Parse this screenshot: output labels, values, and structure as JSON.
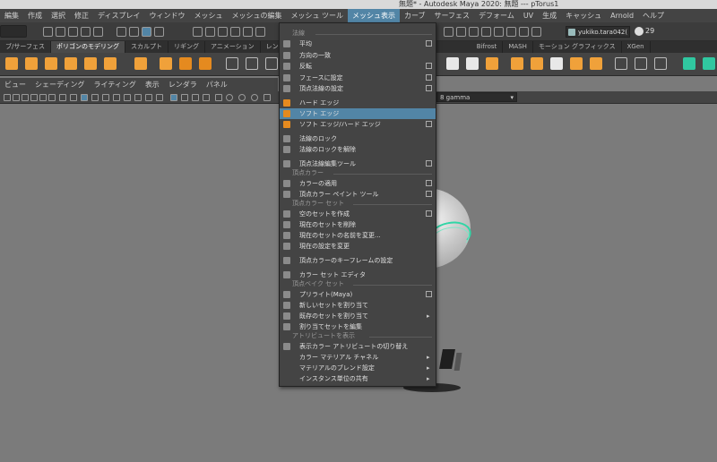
{
  "titlebar": {
    "title": "無題* - Autodesk Maya 2020: 無題   ---   pTorus1"
  },
  "menubar": {
    "items": [
      "編集",
      "作成",
      "選択",
      "修正",
      "ディスプレイ",
      "ウィンドウ",
      "メッシュ",
      "メッシュの編集",
      "メッシュ ツール",
      "メッシュ表示",
      "カーブ",
      "サーフェス",
      "デフォーム",
      "UV",
      "生成",
      "キャッシュ",
      "Arnold",
      "ヘルプ"
    ],
    "active_index": 9
  },
  "status": {
    "user": "yukiko.tara042(",
    "notifications": "29"
  },
  "shelf_tabs": {
    "items": [
      "ブ/サーフェス",
      "ポリゴンのモデリング",
      "スカルプト",
      "リギング",
      "アニメーション",
      "レンダリング",
      "",
      "",
      "",
      "",
      "Bifrost",
      "MASH",
      "モーション グラフィックス",
      "XGen"
    ],
    "active_index": 1
  },
  "viewport_menu": {
    "items": [
      "ビュー",
      "シェーディング",
      "ライティング",
      "表示",
      "レンダラ",
      "パネル"
    ]
  },
  "gamma": {
    "label": "8 gamma"
  },
  "dropdown": {
    "sections": {
      "normals": "法線",
      "vertex_color": "頂点カラー",
      "vertex_color_set": "頂点カラー セット",
      "vertex_bake_set": "頂点ベイク セット",
      "attribute_display": "アトリビュートを表示"
    },
    "items": {
      "average": "平均",
      "conform": "方向の一致",
      "reverse": "反転",
      "set_to_face": "フェースに設定",
      "set_vertex_normal": "頂点法線の設定",
      "hard_edge": "ハード エッジ",
      "soft_edge": "ソフト エッジ",
      "soft_hard_edge": "ソフト エッジ/ハード エッジ",
      "lock_normals": "法線のロック",
      "unlock_normals": "法線のロックを解除",
      "vertex_normal_edit_tool": "頂点法線編集ツール",
      "apply_color": "カラーの適用",
      "vertex_color_paint_tool": "頂点カラー ペイント ツール",
      "create_empty_set": "空のセットを作成",
      "delete_current_set": "現在のセットを削除",
      "rename_current_set": "現在のセットの名前を変更...",
      "modify_current_settings": "現在の設定を変更",
      "vertex_color_keyframe_settings": "頂点カラーのキーフレームの設定",
      "color_set_editor": "カラー セット エディタ",
      "prelight": "プリライト(Maya)",
      "assign_new_set": "新しいセットを割り当て",
      "assign_existing_set": "既存のセットを割り当て",
      "edit_assigned_sets": "割り当てセットを編集",
      "toggle_display_color_attr": "表示カラー アトリビュートの切り替え",
      "color_material_channel": "カラー マテリアル チャネル",
      "material_blend_setting": "マテリアルのブレンド設定",
      "per_instance_sharing": "インスタンス単位の共有"
    },
    "highlighted_item": "ソフト エッジ"
  },
  "colors": {
    "accent": "#5285a6",
    "menu_bg": "#444444",
    "viewport_bg": "#7b7b7b",
    "torus_wire": "#30d6a6",
    "shelf_icon_orange": "#f0a13a"
  }
}
